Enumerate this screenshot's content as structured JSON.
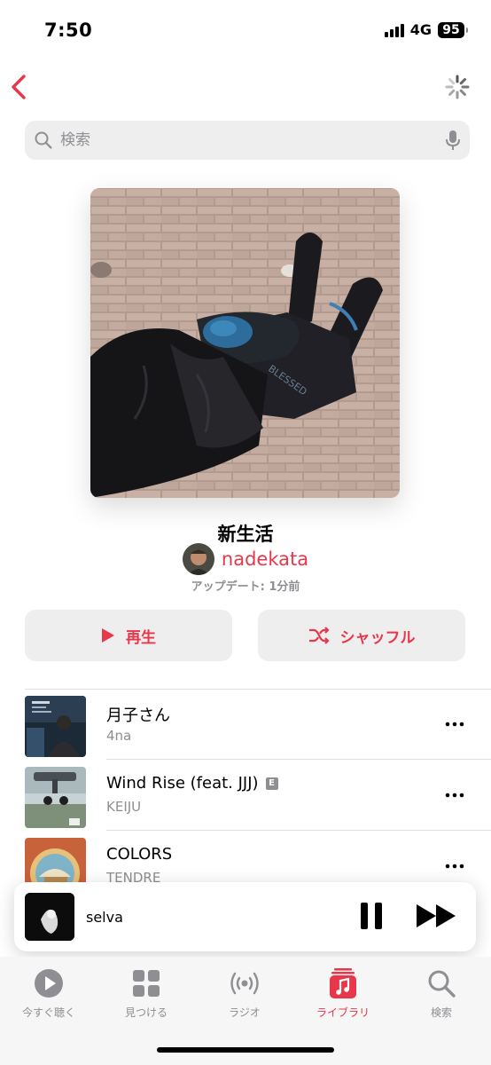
{
  "status": {
    "time": "7:50",
    "network": "4G",
    "battery": "95"
  },
  "search": {
    "placeholder": "検索"
  },
  "playlist": {
    "title": "新生活",
    "owner": "nadekata",
    "updated": "アップデート: 1分前",
    "play_label": "再生",
    "shuffle_label": "シャッフル"
  },
  "tracks": [
    {
      "title": "月子さん",
      "artist": "4na",
      "explicit": false
    },
    {
      "title": "Wind Rise (feat. JJJ)",
      "artist": "KEIJU",
      "explicit": true,
      "explicit_badge": "E"
    },
    {
      "title": "COLORS",
      "artist": "TENDRE",
      "explicit": false
    }
  ],
  "now_playing": {
    "title": "selva"
  },
  "tabs": [
    {
      "label": "今すぐ聴く",
      "icon": "play-circle-icon",
      "active": false
    },
    {
      "label": "見つける",
      "icon": "grid-icon",
      "active": false
    },
    {
      "label": "ラジオ",
      "icon": "radio-waves-icon",
      "active": false
    },
    {
      "label": "ライブラリ",
      "icon": "music-library-icon",
      "active": true
    },
    {
      "label": "検索",
      "icon": "search-icon",
      "active": false
    }
  ],
  "colors": {
    "accent": "#e8364b",
    "secondary_text": "#8e8e93",
    "button_bg": "#eeeeef"
  }
}
